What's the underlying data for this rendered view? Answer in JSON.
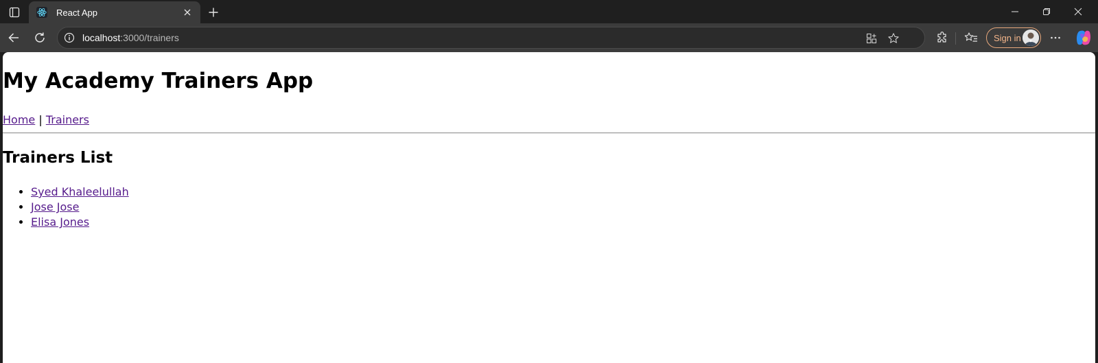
{
  "browser": {
    "tab": {
      "title": "React App",
      "favicon": "react-logo-icon",
      "close_icon": "close-icon"
    },
    "new_tab_icon": "plus-icon",
    "window_controls": [
      "minimize-icon",
      "restore-icon",
      "close-icon"
    ],
    "address": {
      "host": "localhost",
      "path": ":3000/trainers"
    },
    "sign_in_label": "Sign in",
    "icons": [
      "back-arrow-icon",
      "refresh-icon",
      "info-icon",
      "app-available-icon",
      "favorite-star-icon",
      "extensions-icon",
      "favorites-icon",
      "more-icon",
      "copilot-icon"
    ]
  },
  "page": {
    "app_title": "My Academy Trainers App",
    "nav": {
      "home": "Home",
      "separator": " | ",
      "trainers": "Trainers"
    },
    "section_title": "Trainers List",
    "trainers": [
      {
        "name": "Syed Khaleelullah"
      },
      {
        "name": "Jose Jose"
      },
      {
        "name": "Elisa Jones"
      }
    ]
  },
  "colors": {
    "link_visited": "#551a8b",
    "chrome_dark": "#1f1f1f",
    "toolbar": "#3b3b3b",
    "sign_in_accent": "#f3b58a"
  }
}
